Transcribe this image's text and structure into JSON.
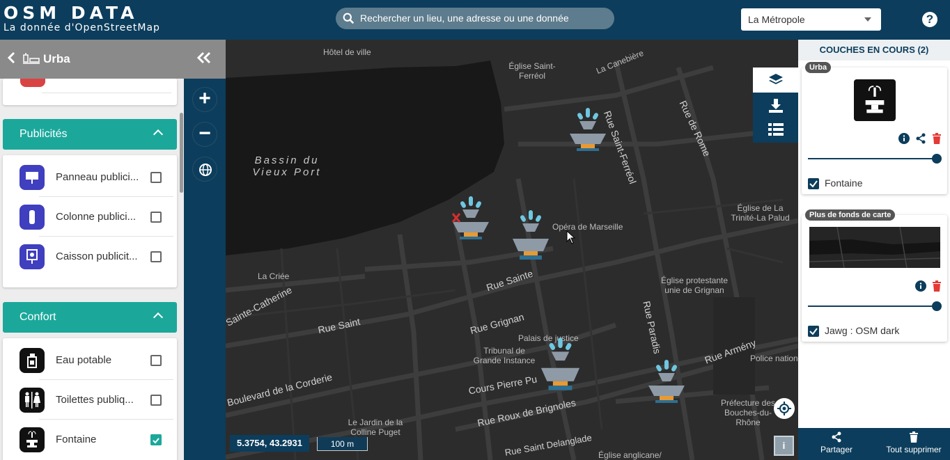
{
  "header": {
    "logo_title": "OSM DATA",
    "logo_subtitle": "La donnée d'OpenStreetMap",
    "search_placeholder": "Rechercher un lieu, une adresse ou une donnée",
    "territory_select": "La Métropole",
    "help_label": "?"
  },
  "left_panel": {
    "back_label": "Urba",
    "sections": [
      {
        "title": "Publicités",
        "items": [
          {
            "label": "Panneau publici...",
            "checked": false,
            "icon": "billboard-icon"
          },
          {
            "label": "Colonne publici...",
            "checked": false,
            "icon": "advertising-column-icon"
          },
          {
            "label": "Caisson publicit...",
            "checked": false,
            "icon": "advertising-box-icon"
          }
        ]
      },
      {
        "title": "Confort",
        "items": [
          {
            "label": "Eau potable",
            "checked": false,
            "icon": "drinking-water-icon"
          },
          {
            "label": "Toilettes publiq...",
            "checked": false,
            "icon": "toilets-icon"
          },
          {
            "label": "Fontaine",
            "checked": true,
            "icon": "fountain-icon"
          }
        ]
      }
    ]
  },
  "map": {
    "labels": {
      "hotel_de_ville": "Hôtel de ville",
      "eglise_saint_ferreol": "Église Saint-Ferréol",
      "la_canebiere": "La Canebière",
      "rue_saint_ferreol": "Rue Saint-Ferréol",
      "rue_de_rome": "Rue de Rome",
      "bassin": "Bassin du Vieux Port",
      "eglise_trinite": "Église de La Trinité-La Palud",
      "opera": "Opéra de Marseille",
      "la_criee": "La Criée",
      "rue_sainte": "Rue Sainte",
      "eglise_protestante": "Église protestante unie de Grignan",
      "sainte_catherine": "Sainte-Catherine",
      "rue_saint": "Rue Saint",
      "rue_grignan": "Rue Grignan",
      "rue_paradis": "Rue Paradis",
      "palais_justice": "Palais de justice",
      "tribunal": "Tribunal de Grande Instance",
      "rue_armeny": "Rue Armény",
      "police": "Police nationa",
      "bd_corderie": "Boulevard de la Corderie",
      "cours_pierre_puget": "Cours Pierre Pu",
      "prefecture": "Préfecture des Bouches-du-Rhône",
      "jardin_colline": "Le Jardin de la Colline Puget",
      "rue_roux": "Rue Roux de Brignoles",
      "delanglade": "Rue Saint Delanglade",
      "eglise_anglicane": "Église anglicane/"
    },
    "coordinates": "5.3754, 43.2931",
    "scale": "100 m",
    "info_button": "i",
    "zoom_in": "+",
    "zoom_out": "−"
  },
  "right_panel": {
    "title": "COUCHES EN COURS (2)",
    "layers": [
      {
        "tag": "Urba",
        "label": "Fontaine",
        "checked": true,
        "opacity": 1.0
      },
      {
        "tag": "Plus de fonds de carte",
        "label": "Jawg : OSM dark",
        "checked": true,
        "opacity": 1.0
      }
    ],
    "footer": {
      "share_label": "Partager",
      "delete_all_label": "Tout supprimer"
    }
  },
  "colors": {
    "header_bg": "#0c3d5c",
    "teal_accent": "#1ba89b",
    "map_bg": "#2c2c2c",
    "ad_icon_bg": "#3f3fbf",
    "delete_red": "#e53935"
  }
}
